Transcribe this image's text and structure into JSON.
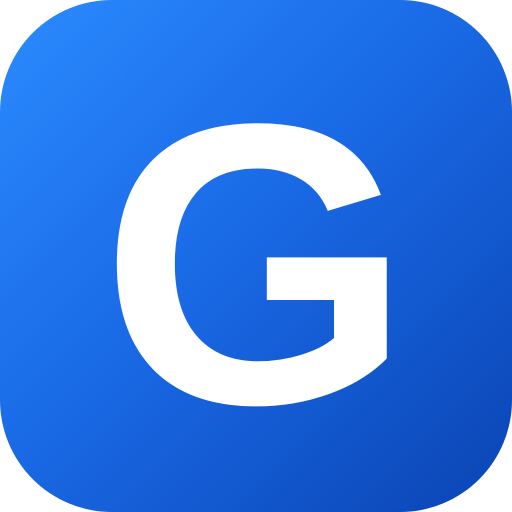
{
  "icon": {
    "letter": "G",
    "background_gradient": [
      "#2b8bff",
      "#1a6ae6",
      "#0a44b4"
    ],
    "letter_color": "#ffffff"
  }
}
